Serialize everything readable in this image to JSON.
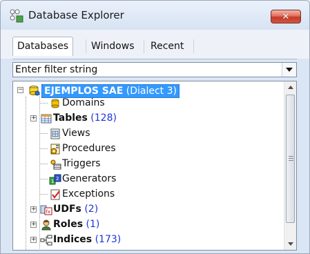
{
  "window": {
    "title": "Database Explorer",
    "close_symbol": "✕"
  },
  "tabs": [
    {
      "label": "Databases",
      "active": true
    },
    {
      "label": "Windows",
      "active": false
    },
    {
      "label": "Recent",
      "active": false
    }
  ],
  "filter": {
    "value": "Enter filter string"
  },
  "tree": {
    "root": {
      "name": "EJEMPLOS SAE",
      "suffix": "(Dialect 3)",
      "expanded": true,
      "selected": true,
      "icon": "database-icon"
    },
    "items": [
      {
        "label": "Domains",
        "bold": false,
        "count": "",
        "expandable": false,
        "icon": "domains-icon"
      },
      {
        "label": "Tables",
        "bold": true,
        "count": "(128)",
        "expandable": true,
        "icon": "tables-icon"
      },
      {
        "label": "Views",
        "bold": false,
        "count": "",
        "expandable": false,
        "icon": "views-icon"
      },
      {
        "label": "Procedures",
        "bold": false,
        "count": "",
        "expandable": false,
        "icon": "procedures-icon"
      },
      {
        "label": "Triggers",
        "bold": false,
        "count": "",
        "expandable": false,
        "icon": "triggers-icon"
      },
      {
        "label": "Generators",
        "bold": false,
        "count": "",
        "expandable": false,
        "icon": "generators-icon"
      },
      {
        "label": "Exceptions",
        "bold": false,
        "count": "",
        "expandable": false,
        "icon": "exceptions-icon"
      },
      {
        "label": "UDFs",
        "bold": true,
        "count": "(2)",
        "expandable": true,
        "icon": "udfs-icon"
      },
      {
        "label": "Roles",
        "bold": true,
        "count": "(1)",
        "expandable": true,
        "icon": "roles-icon"
      },
      {
        "label": "Indices",
        "bold": true,
        "count": "(173)",
        "expandable": true,
        "icon": "indices-icon"
      }
    ]
  },
  "colors": {
    "selection": "#3399ff",
    "count": "#1b34d8",
    "close_button": "#c33b2b"
  }
}
